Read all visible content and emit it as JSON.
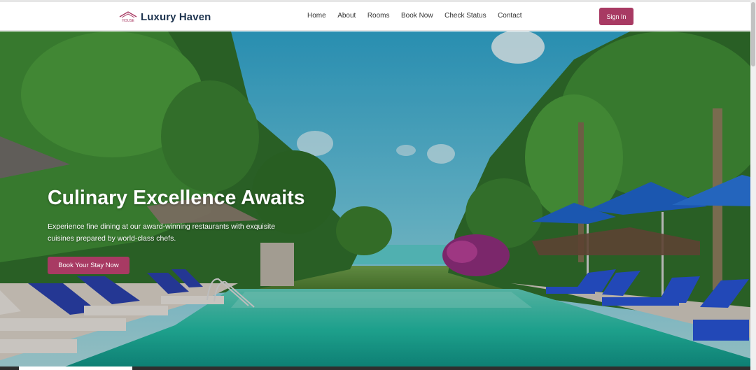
{
  "app": {
    "title": "Luxury Haven"
  },
  "navbar": {
    "brand": {
      "name": "Luxury Haven",
      "logo_icon": "hotel-logo-icon",
      "logo_text": "HOUSE"
    },
    "links": [
      {
        "label": "Home"
      },
      {
        "label": "About"
      },
      {
        "label": "Rooms"
      },
      {
        "label": "Book Now"
      },
      {
        "label": "Check Status"
      },
      {
        "label": "Contact"
      }
    ],
    "signin_label": "Sign In"
  },
  "hero": {
    "title": "Culinary Excellence Awaits",
    "description": "Experience fine dining at our award-winning restaurants with exquisite cuisines prepared by world-class chefs.",
    "cta_label": "Book Your Stay Now",
    "image": "tropical-resort-pool-background"
  },
  "colors": {
    "accent": "#a83a63",
    "brand_text": "#1f3550",
    "nav_text": "#333333"
  }
}
